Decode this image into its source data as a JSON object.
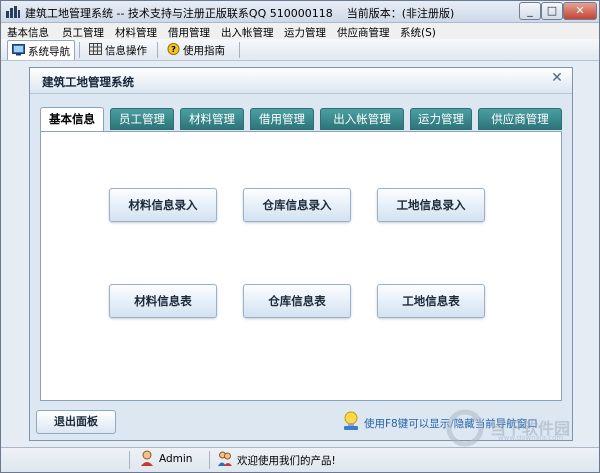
{
  "window": {
    "title": "建筑工地管理系统 -- 技术支持与注册正版联系QQ 510000118",
    "version_label": "当前版本：(非注册版)",
    "minimize": "_",
    "maximize": "□",
    "close": "✕"
  },
  "menu": {
    "items": [
      "基本信息",
      "员工管理",
      "材料管理",
      "借用管理",
      "出入帐管理",
      "运力管理",
      "供应商管理",
      "系统(S)"
    ]
  },
  "toolbar": {
    "nav_label": "系统导航",
    "info_label": "信息操作",
    "help_label": "使用指南"
  },
  "panel": {
    "title": "建筑工地管理系统",
    "close": "✕"
  },
  "tabs": [
    {
      "label": "基本信息",
      "active": true
    },
    {
      "label": "员工管理",
      "active": false
    },
    {
      "label": "材料管理",
      "active": false
    },
    {
      "label": "借用管理",
      "active": false
    },
    {
      "label": "出入帐管理",
      "active": false
    },
    {
      "label": "运力管理",
      "active": false
    },
    {
      "label": "供应商管理",
      "active": false
    }
  ],
  "buttons": {
    "material_entry": "材料信息录入",
    "warehouse_entry": "仓库信息录入",
    "site_entry": "工地信息录入",
    "material_table": "材料信息表",
    "warehouse_table": "仓库信息表",
    "site_table": "工地信息表"
  },
  "footer": {
    "exit_label": "退出面板",
    "hint": "使用F8键可以显示/隐藏当前导航窗口"
  },
  "status": {
    "user": "Admin",
    "welcome": "欢迎使用我们的产品!"
  },
  "watermark": {
    "text": "当下软件园",
    "sub": "www.downxia.com"
  },
  "colors": {
    "tab_bg": "#3a8d91",
    "window_bg": "#e6ecf4",
    "panel_bg": "#dce7f2",
    "hint_blue": "#2563a8"
  }
}
